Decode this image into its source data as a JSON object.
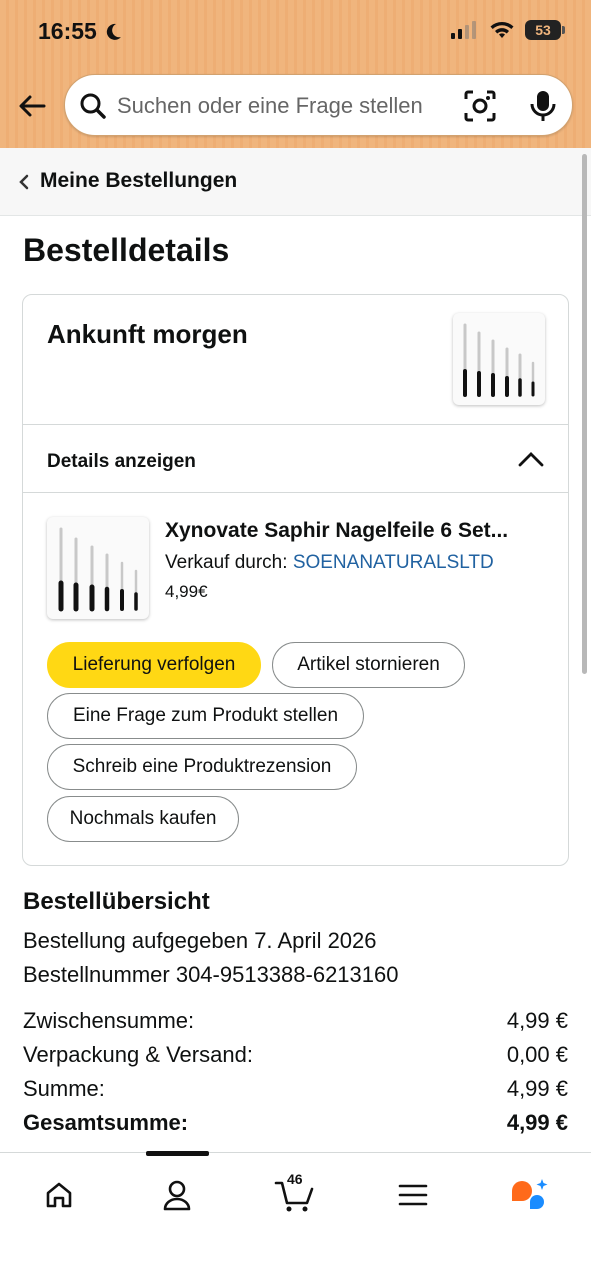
{
  "status_bar": {
    "time": "16:55",
    "battery": "53"
  },
  "search": {
    "placeholder": "Suchen oder eine Frage stellen"
  },
  "breadcrumb": {
    "label": "Meine Bestellungen"
  },
  "page": {
    "title": "Bestelldetails"
  },
  "shipment": {
    "arrival": "Ankunft morgen",
    "details_toggle": "Details anzeigen",
    "item": {
      "title": "Xynovate Saphir Nagelfeile 6 Set...",
      "seller_prefix": "Verkauf durch:",
      "seller": "SOENANATURALSLTD",
      "price": "4,99€"
    },
    "actions": {
      "track": "Lieferung verfolgen",
      "cancel": "Artikel stornieren",
      "question": "Eine Frage zum Produkt stellen",
      "review": "Schreib eine Produktrezension",
      "buy_again": "Nochmals kaufen"
    }
  },
  "summary": {
    "title": "Bestellübersicht",
    "placed": "Bestellung aufgegeben 7. April 2026",
    "order_number": "Bestellnummer 304-9513388-6213160",
    "rows": [
      {
        "label": "Zwischensumme:",
        "value": "4,99 €"
      },
      {
        "label": "Verpackung & Versand:",
        "value": "0,00 €"
      },
      {
        "label": "Summe:",
        "value": "4,99 €"
      },
      {
        "label": "Gesamtsumme:",
        "value": "4,99 €"
      }
    ]
  },
  "nav": {
    "cart_count": "46"
  },
  "colors": {
    "header": "#f0b57d",
    "primary_button": "#ffd814",
    "link": "#2162a1",
    "rufus_orange": "#ff6a1a",
    "rufus_blue": "#1a8cff"
  }
}
